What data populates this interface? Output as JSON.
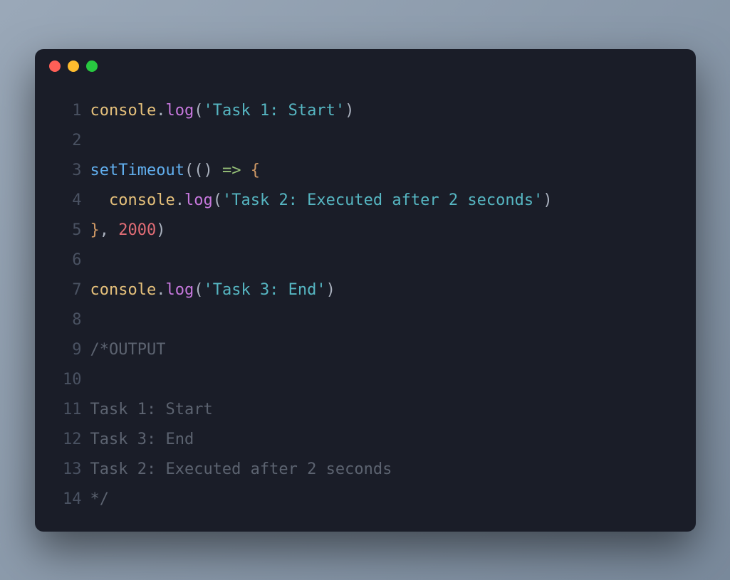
{
  "window": {
    "traffic_lights": [
      "red",
      "yellow",
      "green"
    ]
  },
  "code": {
    "lines": [
      {
        "num": "1",
        "tokens": [
          {
            "cls": "tok-ident",
            "t": "console"
          },
          {
            "cls": "tok-punct",
            "t": "."
          },
          {
            "cls": "tok-method",
            "t": "log"
          },
          {
            "cls": "tok-punct",
            "t": "("
          },
          {
            "cls": "tok-string",
            "t": "'Task 1: Start'"
          },
          {
            "cls": "tok-punct",
            "t": ")"
          }
        ]
      },
      {
        "num": "2",
        "tokens": []
      },
      {
        "num": "3",
        "tokens": [
          {
            "cls": "tok-func",
            "t": "setTimeout"
          },
          {
            "cls": "tok-punct",
            "t": "(("
          },
          {
            "cls": "tok-punct",
            "t": ") "
          },
          {
            "cls": "tok-arrow",
            "t": "=>"
          },
          {
            "cls": "tok-punct",
            "t": " "
          },
          {
            "cls": "tok-brace",
            "t": "{"
          }
        ]
      },
      {
        "num": "4",
        "tokens": [
          {
            "cls": "tok-punct",
            "t": "  "
          },
          {
            "cls": "tok-ident",
            "t": "console"
          },
          {
            "cls": "tok-punct",
            "t": "."
          },
          {
            "cls": "tok-method",
            "t": "log"
          },
          {
            "cls": "tok-punct",
            "t": "("
          },
          {
            "cls": "tok-string",
            "t": "'Task 2: Executed after 2 seconds'"
          },
          {
            "cls": "tok-punct",
            "t": ")"
          }
        ]
      },
      {
        "num": "5",
        "tokens": [
          {
            "cls": "tok-brace",
            "t": "}"
          },
          {
            "cls": "tok-punct",
            "t": ", "
          },
          {
            "cls": "tok-number",
            "t": "2000"
          },
          {
            "cls": "tok-punct",
            "t": ")"
          }
        ]
      },
      {
        "num": "6",
        "tokens": []
      },
      {
        "num": "7",
        "tokens": [
          {
            "cls": "tok-ident",
            "t": "console"
          },
          {
            "cls": "tok-punct",
            "t": "."
          },
          {
            "cls": "tok-method",
            "t": "log"
          },
          {
            "cls": "tok-punct",
            "t": "("
          },
          {
            "cls": "tok-string",
            "t": "'Task 3: End'"
          },
          {
            "cls": "tok-punct",
            "t": ")"
          }
        ]
      },
      {
        "num": "8",
        "tokens": []
      },
      {
        "num": "9",
        "tokens": [
          {
            "cls": "tok-comment",
            "t": "/*OUTPUT"
          }
        ]
      },
      {
        "num": "10",
        "tokens": []
      },
      {
        "num": "11",
        "tokens": [
          {
            "cls": "tok-comment",
            "t": "Task 1: Start"
          }
        ]
      },
      {
        "num": "12",
        "tokens": [
          {
            "cls": "tok-comment",
            "t": "Task 3: End"
          }
        ]
      },
      {
        "num": "13",
        "tokens": [
          {
            "cls": "tok-comment",
            "t": "Task 2: Executed after 2 seconds"
          }
        ]
      },
      {
        "num": "14",
        "tokens": [
          {
            "cls": "tok-comment",
            "t": "*/"
          }
        ]
      }
    ]
  }
}
